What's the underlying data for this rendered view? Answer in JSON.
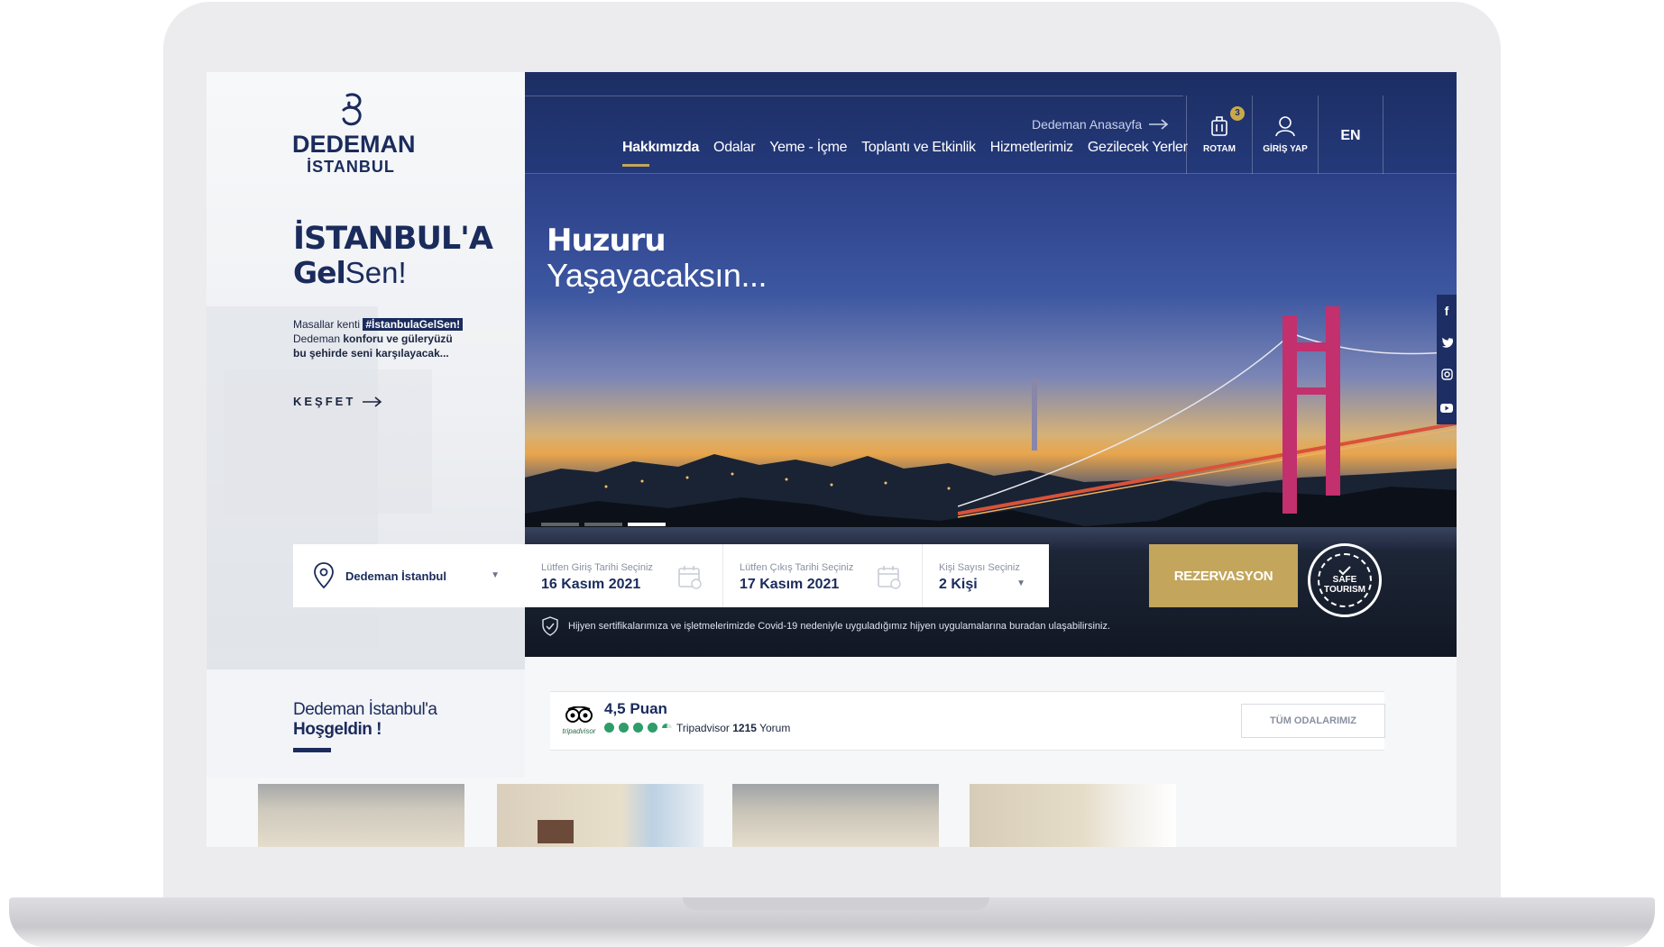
{
  "brand": {
    "name": "DEDEMAN",
    "city": "İSTANBUL"
  },
  "left": {
    "title_line1": "İSTANBUL'A",
    "title_bold": "Gel",
    "title_rest": "Sen!",
    "intro_pre": "Masallar kenti ",
    "intro_hashtag": "#İstanbulaGelSen!",
    "intro_line2_a": "Dedeman ",
    "intro_line2_b": "konforu ve güleryüzü",
    "intro_line3": "bu şehirde seni karşılayacak...",
    "discover": "KEŞFET"
  },
  "nav": {
    "home_link": "Dedeman Anasayfa",
    "items": [
      "Hakkımızda",
      "Odalar",
      "Yeme - İçme",
      "Toplantı ve Etkinlik",
      "Hizmetlerimiz",
      "Gezilecek Yerler"
    ],
    "route_label": "ROTAM",
    "route_badge": "3",
    "login_label": "GİRİŞ YAP",
    "lang": "EN"
  },
  "hero": {
    "title_bold": "Huzuru",
    "title_light": "Yaşayacaksın..."
  },
  "booking": {
    "hotel": "Dedeman İstanbul",
    "checkin_label": "Lütfen Giriş Tarihi Seçiniz",
    "checkin_value": "16 Kasım 2021",
    "checkout_label": "Lütfen Çıkış Tarihi Seçiniz",
    "checkout_value": "17 Kasım 2021",
    "guests_label": "Kişi Sayısı Seçiniz",
    "guests_value": "2 Kişi",
    "reserve": "REZERVASYON"
  },
  "seal": {
    "line1": "SAFE",
    "line2": "TOURISM"
  },
  "hygiene_note": "Hijyen sertifikalarımıza ve işletmelerimizde Covid-19 nedeniyle uyguladığımız hijyen uygulamalarına buradan ulaşabilirsiniz.",
  "welcome": {
    "line1": "Dedeman İstanbul'a",
    "line2": "Hoşgeldin !"
  },
  "rating": {
    "score": "4,5 Puan",
    "stars": 4.5,
    "source": "Tripadvisor",
    "count": "1215",
    "suffix": "Yorum",
    "logo_text": "tripadvisor"
  },
  "all_rooms": "TÜM ODALARIMIZ",
  "social": [
    "f",
    "t",
    "ig",
    "yt"
  ],
  "colors": {
    "navy": "#1a2b5c",
    "gold": "#c3a65c",
    "tripadvisor_green": "#2e9d6a"
  }
}
